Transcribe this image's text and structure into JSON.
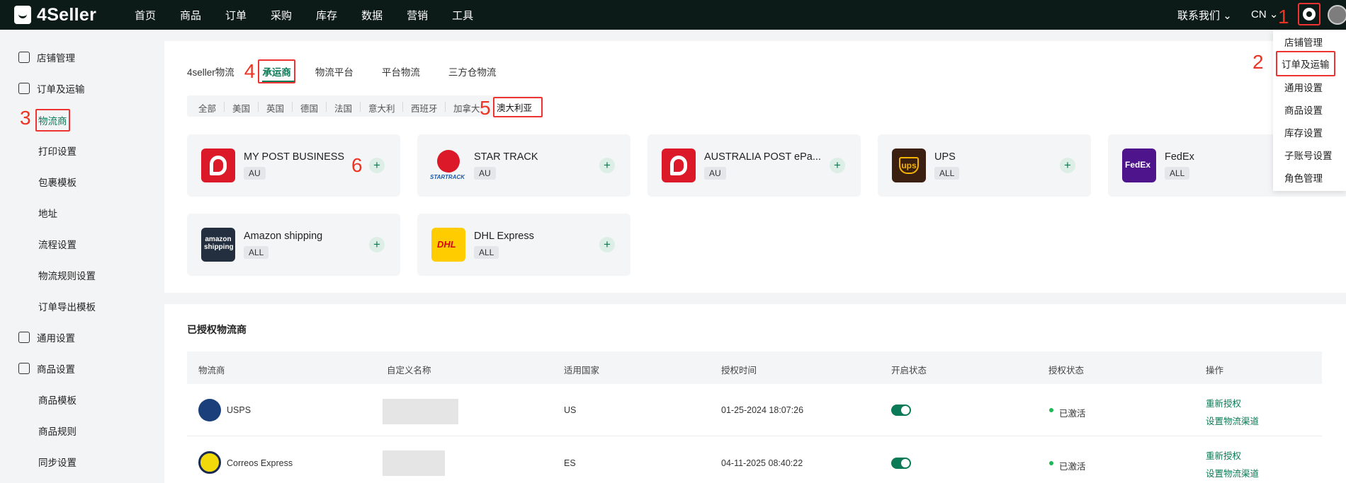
{
  "brand": {
    "name": "4Seller"
  },
  "topnav": [
    "首页",
    "商品",
    "订单",
    "采购",
    "库存",
    "数据",
    "营销",
    "工具"
  ],
  "topright": {
    "contact": "联系我们",
    "lang": "CN"
  },
  "annotations": [
    "1",
    "2",
    "3",
    "4",
    "5",
    "6"
  ],
  "sidebar": {
    "store": "店铺管理",
    "order_shipping": "订单及运输",
    "logistics": "物流商",
    "print": "打印设置",
    "package": "包裹模板",
    "address": "地址",
    "workflow": "流程设置",
    "rules": "物流规则设置",
    "export": "订单导出模板",
    "general": "通用设置",
    "product": "商品设置",
    "product_tpl": "商品模板",
    "product_rule": "商品规则",
    "sync": "同步设置"
  },
  "tabs": [
    "4seller物流",
    "承运商",
    "物流平台",
    "平台物流",
    "三方仓物流"
  ],
  "countries": [
    "全部",
    "美国",
    "英国",
    "德国",
    "法国",
    "意大利",
    "西班牙",
    "加拿大",
    "澳大利亚"
  ],
  "carriers": [
    {
      "name": "MY POST BUSINESS",
      "region": "AU"
    },
    {
      "name": "STAR TRACK",
      "region": "AU",
      "logo_text": "STARTRACK"
    },
    {
      "name": "AUSTRALIA POST ePa...",
      "region": "AU"
    },
    {
      "name": "UPS",
      "region": "ALL",
      "logo_text": "ups"
    },
    {
      "name": "FedEx",
      "region": "ALL",
      "logo_text": "FedEx"
    },
    {
      "name": "Amazon shipping",
      "region": "ALL",
      "logo_text": "amazon shipping"
    },
    {
      "name": "DHL Express",
      "region": "ALL",
      "logo_text": "DHL"
    }
  ],
  "authorized": {
    "title": "已授权物流商",
    "columns": [
      "物流商",
      "自定义名称",
      "适用国家",
      "授权时间",
      "开启状态",
      "授权状态",
      "操作"
    ],
    "rows": [
      {
        "carrier": "USPS",
        "country": "US",
        "time": "01-25-2024 18:07:26",
        "status": "已激活",
        "action1": "重新授权",
        "action2": "设置物流渠道"
      },
      {
        "carrier": "Correos Express",
        "country": "ES",
        "time": "04-11-2025 08:40:22",
        "status": "已激活",
        "action1": "重新授权",
        "action2": "设置物流渠道"
      }
    ]
  },
  "dropdown": [
    "店铺管理",
    "订单及运输",
    "通用设置",
    "商品设置",
    "库存设置",
    "子账号设置",
    "角色管理"
  ]
}
